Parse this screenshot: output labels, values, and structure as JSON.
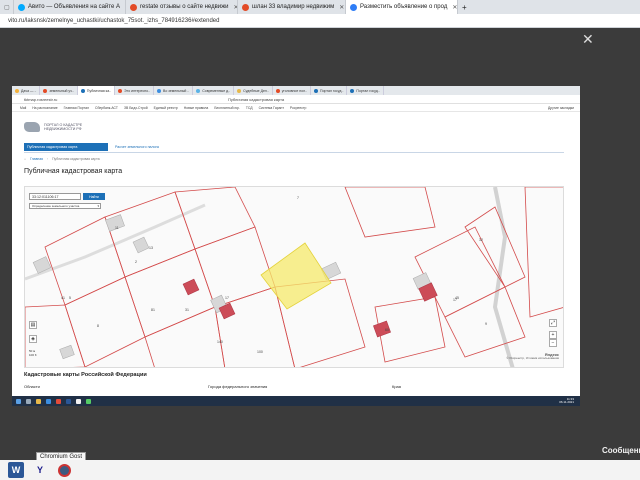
{
  "outer_browser": {
    "tabs": [
      {
        "label": "Авито — Объявления на сайте А",
        "color": "#00aaff",
        "active": false
      },
      {
        "label": "restate отзывы о сайте недвижи",
        "color": "#e34b26",
        "active": false
      },
      {
        "label": "шлан 33 владимир недвижим",
        "color": "#e34b26",
        "active": false
      },
      {
        "label": "Разместить объявление о прод",
        "color": "#2e7df6",
        "active": true
      }
    ],
    "new_tab": "+",
    "url": "vito.ru/laksnsk/zemelnye_uchastki/uchastok_75sot._izhs_784916236#extended"
  },
  "overlay": {
    "close_glyph": "✕"
  },
  "inner_browser": {
    "tabs": [
      "Дача — ..",
      "земельный уч..",
      "Публичная ка..",
      "Это интересно..",
      "Во земельный ..",
      "Современные д..",
      "Судебные Дел..",
      "уголовное пол..",
      "Портал госуд..",
      "Портал госуд.."
    ],
    "url": "tktmap.rosreestr.ru",
    "page_title": "Публичная кадастровая карта",
    "bookmarks": [
      "Mail",
      "На распознание",
      "Главная Портал",
      "Сбербанк-АСТ",
      "ЗВ Бидз-Строй",
      "Единый реестр",
      "Новые правила",
      "Бесплатный юр.",
      "ТСД",
      "Система Гарант",
      "Росреестр"
    ],
    "bookmarks_right": "Другие закладки"
  },
  "portal": {
    "name_line1": "ПОРТАЛ О КАДАСТРЕ",
    "name_line2": "НЕДВИЖИМОСТИ РФ"
  },
  "nav": {
    "active": "Публичная кадастровая карта",
    "link": "Расчет земельного налога"
  },
  "breadcrumbs": [
    "Главная",
    "Публичная кадастровая карта"
  ],
  "heading": "Публичная кадастровая карта",
  "map": {
    "search_value": "33:12:011106:17",
    "search_button": "Найти",
    "select_value": "Определение земельного участка",
    "zoom_in": "+",
    "zoom_out": "−",
    "scale_top": "50 м",
    "scale_bottom": "100 ft",
    "credit_line1": "Яндекс",
    "credit_line2": "© Росреестр, Условия использования",
    "labels": [
      "7",
      "11",
      "13",
      "2",
      "5",
      "32",
      "31",
      "81",
      "140",
      "100",
      "45",
      "8",
      "41",
      "17",
      "60",
      "9",
      "17"
    ]
  },
  "section": {
    "title": "Кадастровые карты Российской Федерации",
    "columns": [
      "Области",
      "Города федерального значения",
      "Края"
    ]
  },
  "inner_taskbar": {
    "clock_time": "11:33",
    "clock_date": "06.11.2021"
  },
  "side_text": "Сообщени",
  "taskbar": {
    "tooltip": "Chromium Gost"
  }
}
